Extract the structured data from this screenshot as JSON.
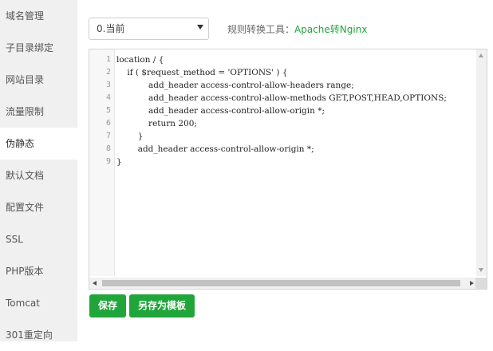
{
  "sidebar": {
    "items": [
      {
        "label": "域名管理"
      },
      {
        "label": "子目录绑定"
      },
      {
        "label": "网站目录"
      },
      {
        "label": "流量限制"
      },
      {
        "label": "伪静态",
        "active": true
      },
      {
        "label": "默认文档"
      },
      {
        "label": "配置文件"
      },
      {
        "label": "SSL"
      },
      {
        "label": "PHP版本"
      },
      {
        "label": "Tomcat"
      },
      {
        "label": "301重定向"
      }
    ]
  },
  "rewrite": {
    "selected_rule": "0.当前",
    "rule_tool_label": "规则转换工具：",
    "rule_tool_link": "Apache转Nginx"
  },
  "editor": {
    "line_numbers": [
      "1",
      "2",
      "3",
      "4",
      "5",
      "6",
      "7",
      "8",
      "9"
    ],
    "lines": [
      "location / {",
      "    if ( $request_method = 'OPTIONS' ) {",
      "            add_header access-control-allow-headers range;",
      "            add_header access-control-allow-methods GET,POST,HEAD,OPTIONS;",
      "            add_header access-control-allow-origin *;",
      "            return 200;",
      "        }",
      "        add_header access-control-allow-origin *;",
      "}"
    ]
  },
  "buttons": {
    "save": "保存",
    "save_as_template": "另存为模板"
  },
  "colors": {
    "accent": "#20a53a",
    "sidebar_bg": "#f0f0f0"
  }
}
